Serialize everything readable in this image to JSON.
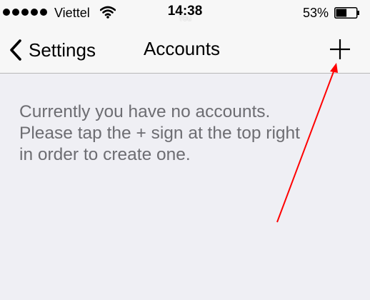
{
  "status_bar": {
    "carrier": "Viettel",
    "time": "14:38",
    "time_sub": "You",
    "battery_percent": "53%",
    "battery_level": 0.53,
    "icons": [
      "signal-dots-icon",
      "wifi-icon",
      "battery-icon"
    ]
  },
  "nav": {
    "back_label": "Settings",
    "title": "Accounts",
    "add_icon": "plus-icon"
  },
  "content": {
    "message_lines": [
      "Currently you have no accounts.",
      "Please tap the + sign at the top right",
      "in order to create one."
    ]
  },
  "annotation": {
    "color": "#ff0000",
    "icon": "red-arrow-pointing-to-add-button"
  },
  "colors": {
    "background": "#efeff4",
    "bar": "#f7f7f7",
    "message_text": "#6d6d72"
  }
}
